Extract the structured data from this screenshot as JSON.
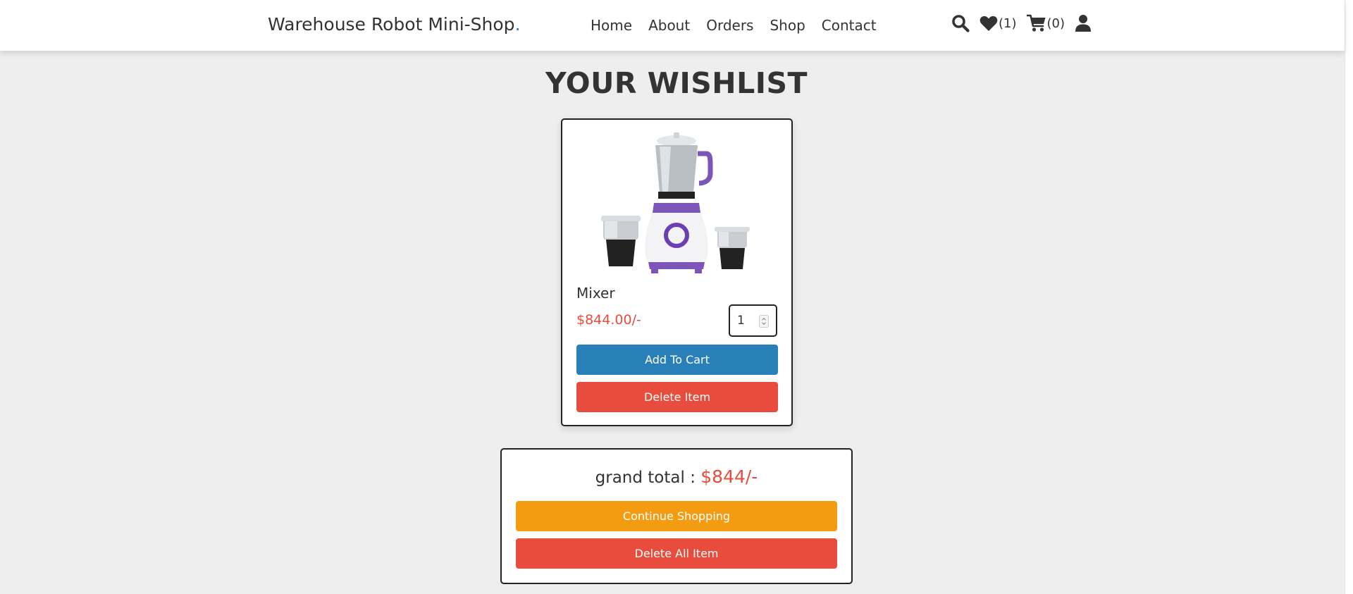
{
  "header": {
    "logo": "Warehouse Robot Mini-Shop",
    "logo_dot": ".",
    "nav": [
      "Home",
      "About",
      "Orders",
      "Shop",
      "Contact"
    ],
    "wishlist_count": "(1)",
    "cart_count": "(0)",
    "icons": [
      "search-icon",
      "heart-icon",
      "cart-icon",
      "user-icon"
    ]
  },
  "page": {
    "title": "YOUR WISHLIST"
  },
  "wishlist": {
    "items": [
      {
        "name": "Mixer",
        "price": "$844.00/-",
        "quantity": "1",
        "add_to_cart_label": "Add To Cart",
        "delete_label": "Delete Item"
      }
    ]
  },
  "summary": {
    "grand_total_label": "grand total : ",
    "grand_total_value": "$844/-",
    "continue_label": "Continue Shopping",
    "delete_all_label": "Delete All Item"
  },
  "colors": {
    "primary": "#2980b9",
    "danger": "#e74c3c",
    "warning": "#f39c12",
    "text": "#333333",
    "background": "#eeeeee"
  }
}
